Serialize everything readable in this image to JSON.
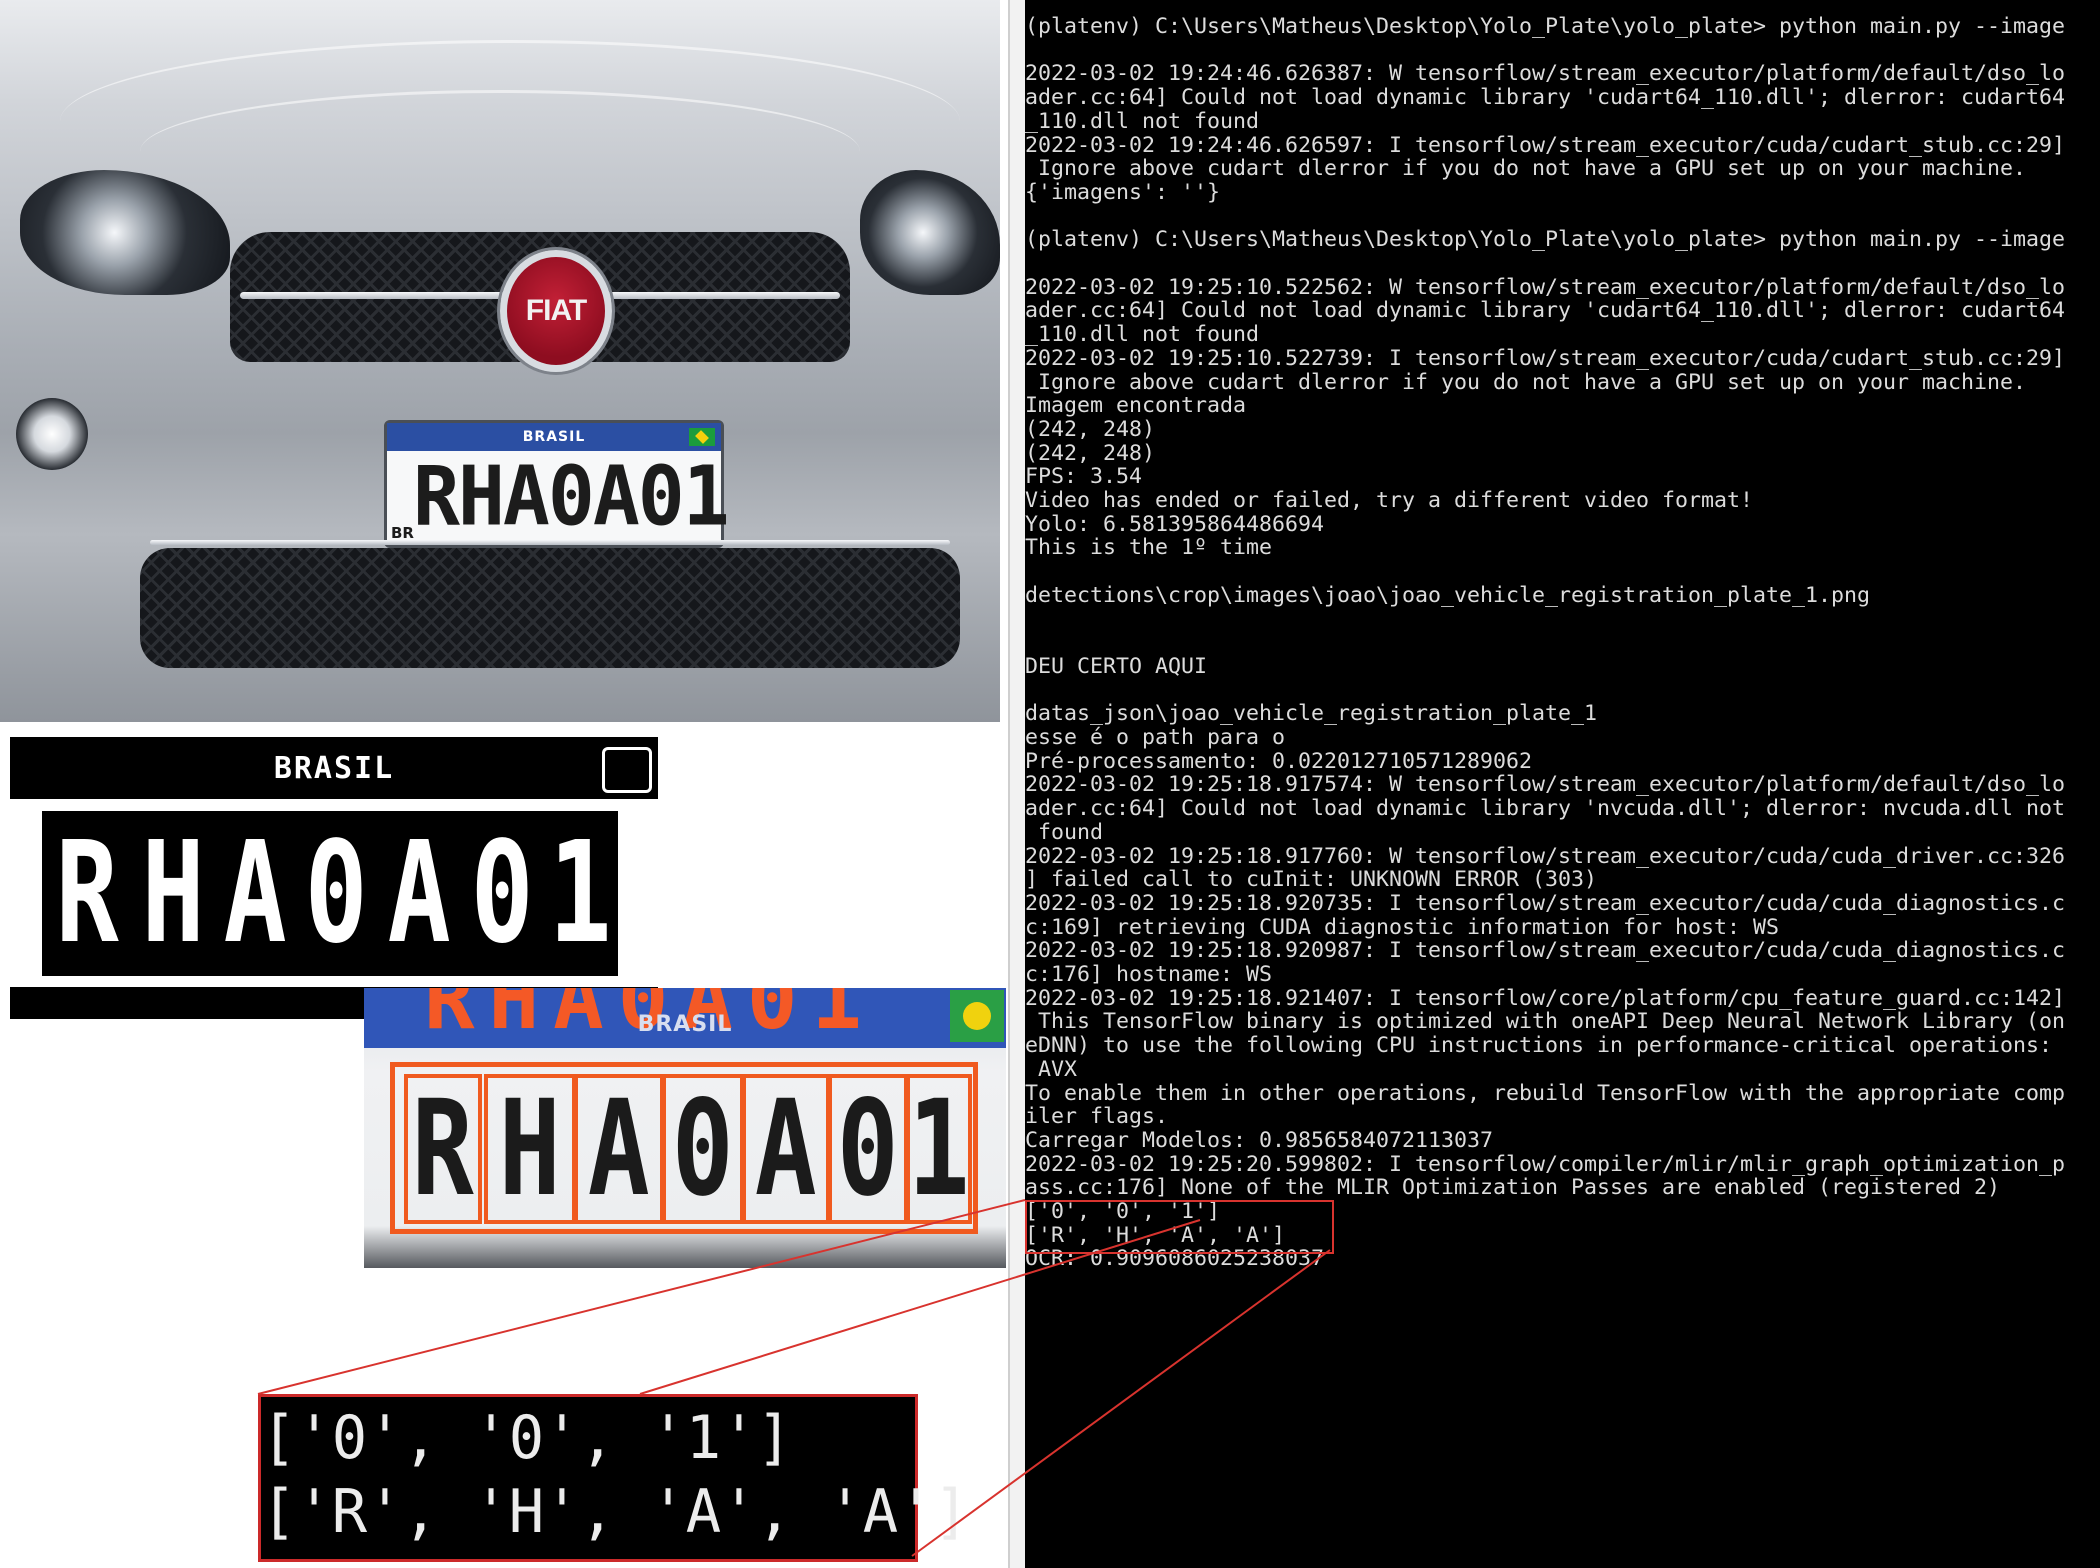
{
  "car_photo": {
    "badge": "FIAT",
    "plate_header": "BRASIL",
    "plate_number": "RHA0A01",
    "plate_country": "BR"
  },
  "binarized_plate": {
    "header": "BRASIL",
    "characters": [
      "R",
      "H",
      "A",
      "0",
      "A",
      "0",
      "1"
    ]
  },
  "detected_plate": {
    "header": "BRASIL",
    "characters": [
      "R",
      "H",
      "A",
      "0",
      "A",
      "0",
      "1"
    ]
  },
  "ocr_zoom": {
    "line1": "['0', '0', '1']",
    "line2": "['R', 'H', 'A', 'A']"
  },
  "terminal": {
    "lines": [
      "(platenv) C:\\Users\\Matheus\\Desktop\\Yolo_Plate\\yolo_plate> python main.py --image",
      "",
      "2022-03-02 19:24:46.626387: W tensorflow/stream_executor/platform/default/dso_lo",
      "ader.cc:64] Could not load dynamic library 'cudart64_110.dll'; dlerror: cudart64",
      "_110.dll not found",
      "2022-03-02 19:24:46.626597: I tensorflow/stream_executor/cuda/cudart_stub.cc:29]",
      " Ignore above cudart dlerror if you do not have a GPU set up on your machine.",
      "{'imagens': ''}",
      "",
      "(platenv) C:\\Users\\Matheus\\Desktop\\Yolo_Plate\\yolo_plate> python main.py --image",
      "",
      "2022-03-02 19:25:10.522562: W tensorflow/stream_executor/platform/default/dso_lo",
      "ader.cc:64] Could not load dynamic library 'cudart64_110.dll'; dlerror: cudart64",
      "_110.dll not found",
      "2022-03-02 19:25:10.522739: I tensorflow/stream_executor/cuda/cudart_stub.cc:29]",
      " Ignore above cudart dlerror if you do not have a GPU set up on your machine.",
      "Imagem encontrada",
      "(242, 248)",
      "(242, 248)",
      "FPS: 3.54",
      "Video has ended or failed, try a different video format!",
      "Yolo: 6.581395864486694",
      "This is the 1º time",
      "",
      "detections\\crop\\images\\joao\\joao_vehicle_registration_plate_1.png",
      "",
      "",
      "DEU CERTO AQUI",
      "",
      "datas_json\\joao_vehicle_registration_plate_1",
      "esse é o path para o",
      "Pré-processamento: 0.022012710571289062",
      "2022-03-02 19:25:18.917574: W tensorflow/stream_executor/platform/default/dso_lo",
      "ader.cc:64] Could not load dynamic library 'nvcuda.dll'; dlerror: nvcuda.dll not",
      " found",
      "2022-03-02 19:25:18.917760: W tensorflow/stream_executor/cuda/cuda_driver.cc:326",
      "] failed call to cuInit: UNKNOWN ERROR (303)",
      "2022-03-02 19:25:18.920735: I tensorflow/stream_executor/cuda/cuda_diagnostics.c",
      "c:169] retrieving CUDA diagnostic information for host: WS",
      "2022-03-02 19:25:18.920987: I tensorflow/stream_executor/cuda/cuda_diagnostics.c",
      "c:176] hostname: WS",
      "2022-03-02 19:25:18.921407: I tensorflow/core/platform/cpu_feature_guard.cc:142]",
      " This TensorFlow binary is optimized with oneAPI Deep Neural Network Library (on",
      "eDNN) to use the following CPU instructions in performance-critical operations:",
      " AVX",
      "To enable them in other operations, rebuild TensorFlow with the appropriate comp",
      "iler flags.",
      "Carregar Modelos: 0.9856584072113037",
      "2022-03-02 19:25:20.599802: I tensorflow/compiler/mlir/mlir_graph_optimization_p",
      "ass.cc:176] None of the MLIR Optimization Passes are enabled (registered 2)",
      "['0', '0', '1']",
      "['R', 'H', 'A', 'A']",
      "OCR: 0.9096086025238037"
    ]
  },
  "colors": {
    "highlight_red": "#d8332e",
    "detection_orange": "#f05a1f",
    "plate_blue": "#2b4fa3"
  }
}
